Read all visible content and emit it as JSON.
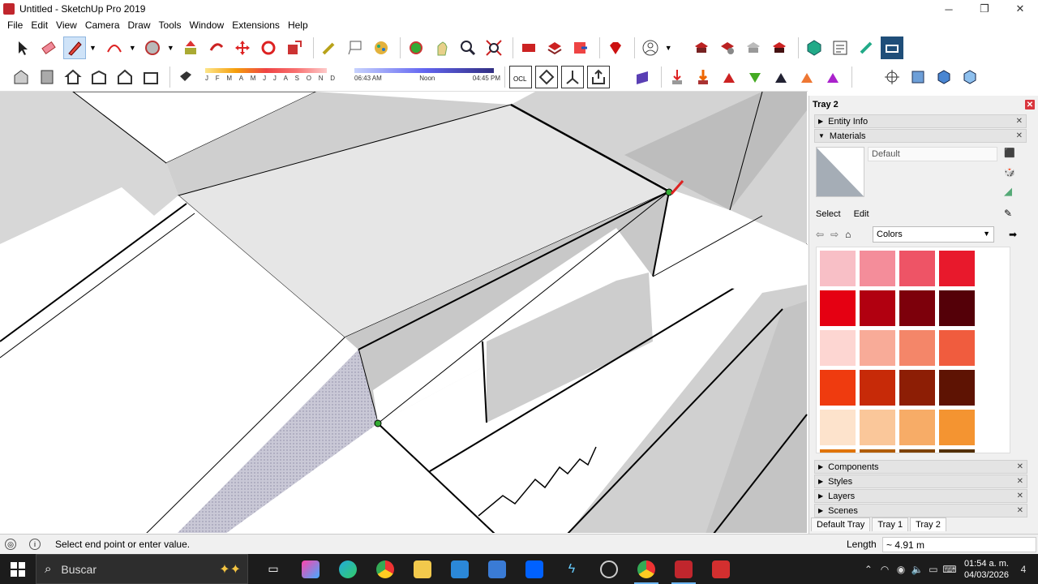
{
  "window": {
    "title": "Untitled - SketchUp Pro 2019"
  },
  "menu": [
    "File",
    "Edit",
    "View",
    "Camera",
    "Draw",
    "Tools",
    "Window",
    "Extensions",
    "Help"
  ],
  "shadow": {
    "months": [
      "J",
      "F",
      "M",
      "A",
      "M",
      "J",
      "J",
      "A",
      "S",
      "O",
      "N",
      "D"
    ],
    "sunrise": "06:43 AM",
    "noon": "Noon",
    "sunset": "04:45 PM"
  },
  "toolbar2": {
    "ocl_label": "OCL"
  },
  "tray": {
    "title": "Tray 2",
    "panels_top": [
      {
        "label": "Entity Info",
        "expanded": false
      },
      {
        "label": "Materials",
        "expanded": true
      }
    ],
    "material_name": "Default",
    "tabs": [
      "Select",
      "Edit"
    ],
    "library": "Colors",
    "swatches": [
      "#f8bfc6",
      "#f48d9a",
      "#ee5466",
      "#e8192c",
      "#e50012",
      "#b10010",
      "#7d000b",
      "#540008",
      "#fdd6d2",
      "#f8ab98",
      "#f48669",
      "#f05c3e",
      "#ef3b0f",
      "#c72a08",
      "#8d1e05",
      "#5e1303",
      "#fde3cc",
      "#fac79a",
      "#f7ac67",
      "#f49431",
      "#e07408",
      "#b15d06",
      "#7e4305",
      "#533002"
    ],
    "panels_bottom": [
      "Components",
      "Styles",
      "Layers",
      "Scenes"
    ],
    "tray_tabs": [
      "Default Tray",
      "Tray 1",
      "Tray 2"
    ],
    "active_tab": "Tray 2"
  },
  "status": {
    "message": "Select end point or enter value.",
    "measure_label": "Length",
    "measure_value": "~ 4.91 m"
  },
  "taskbar": {
    "search_placeholder": "Buscar",
    "time": "01:54 a. m.",
    "date": "04/03/2026",
    "notifications": "4"
  }
}
